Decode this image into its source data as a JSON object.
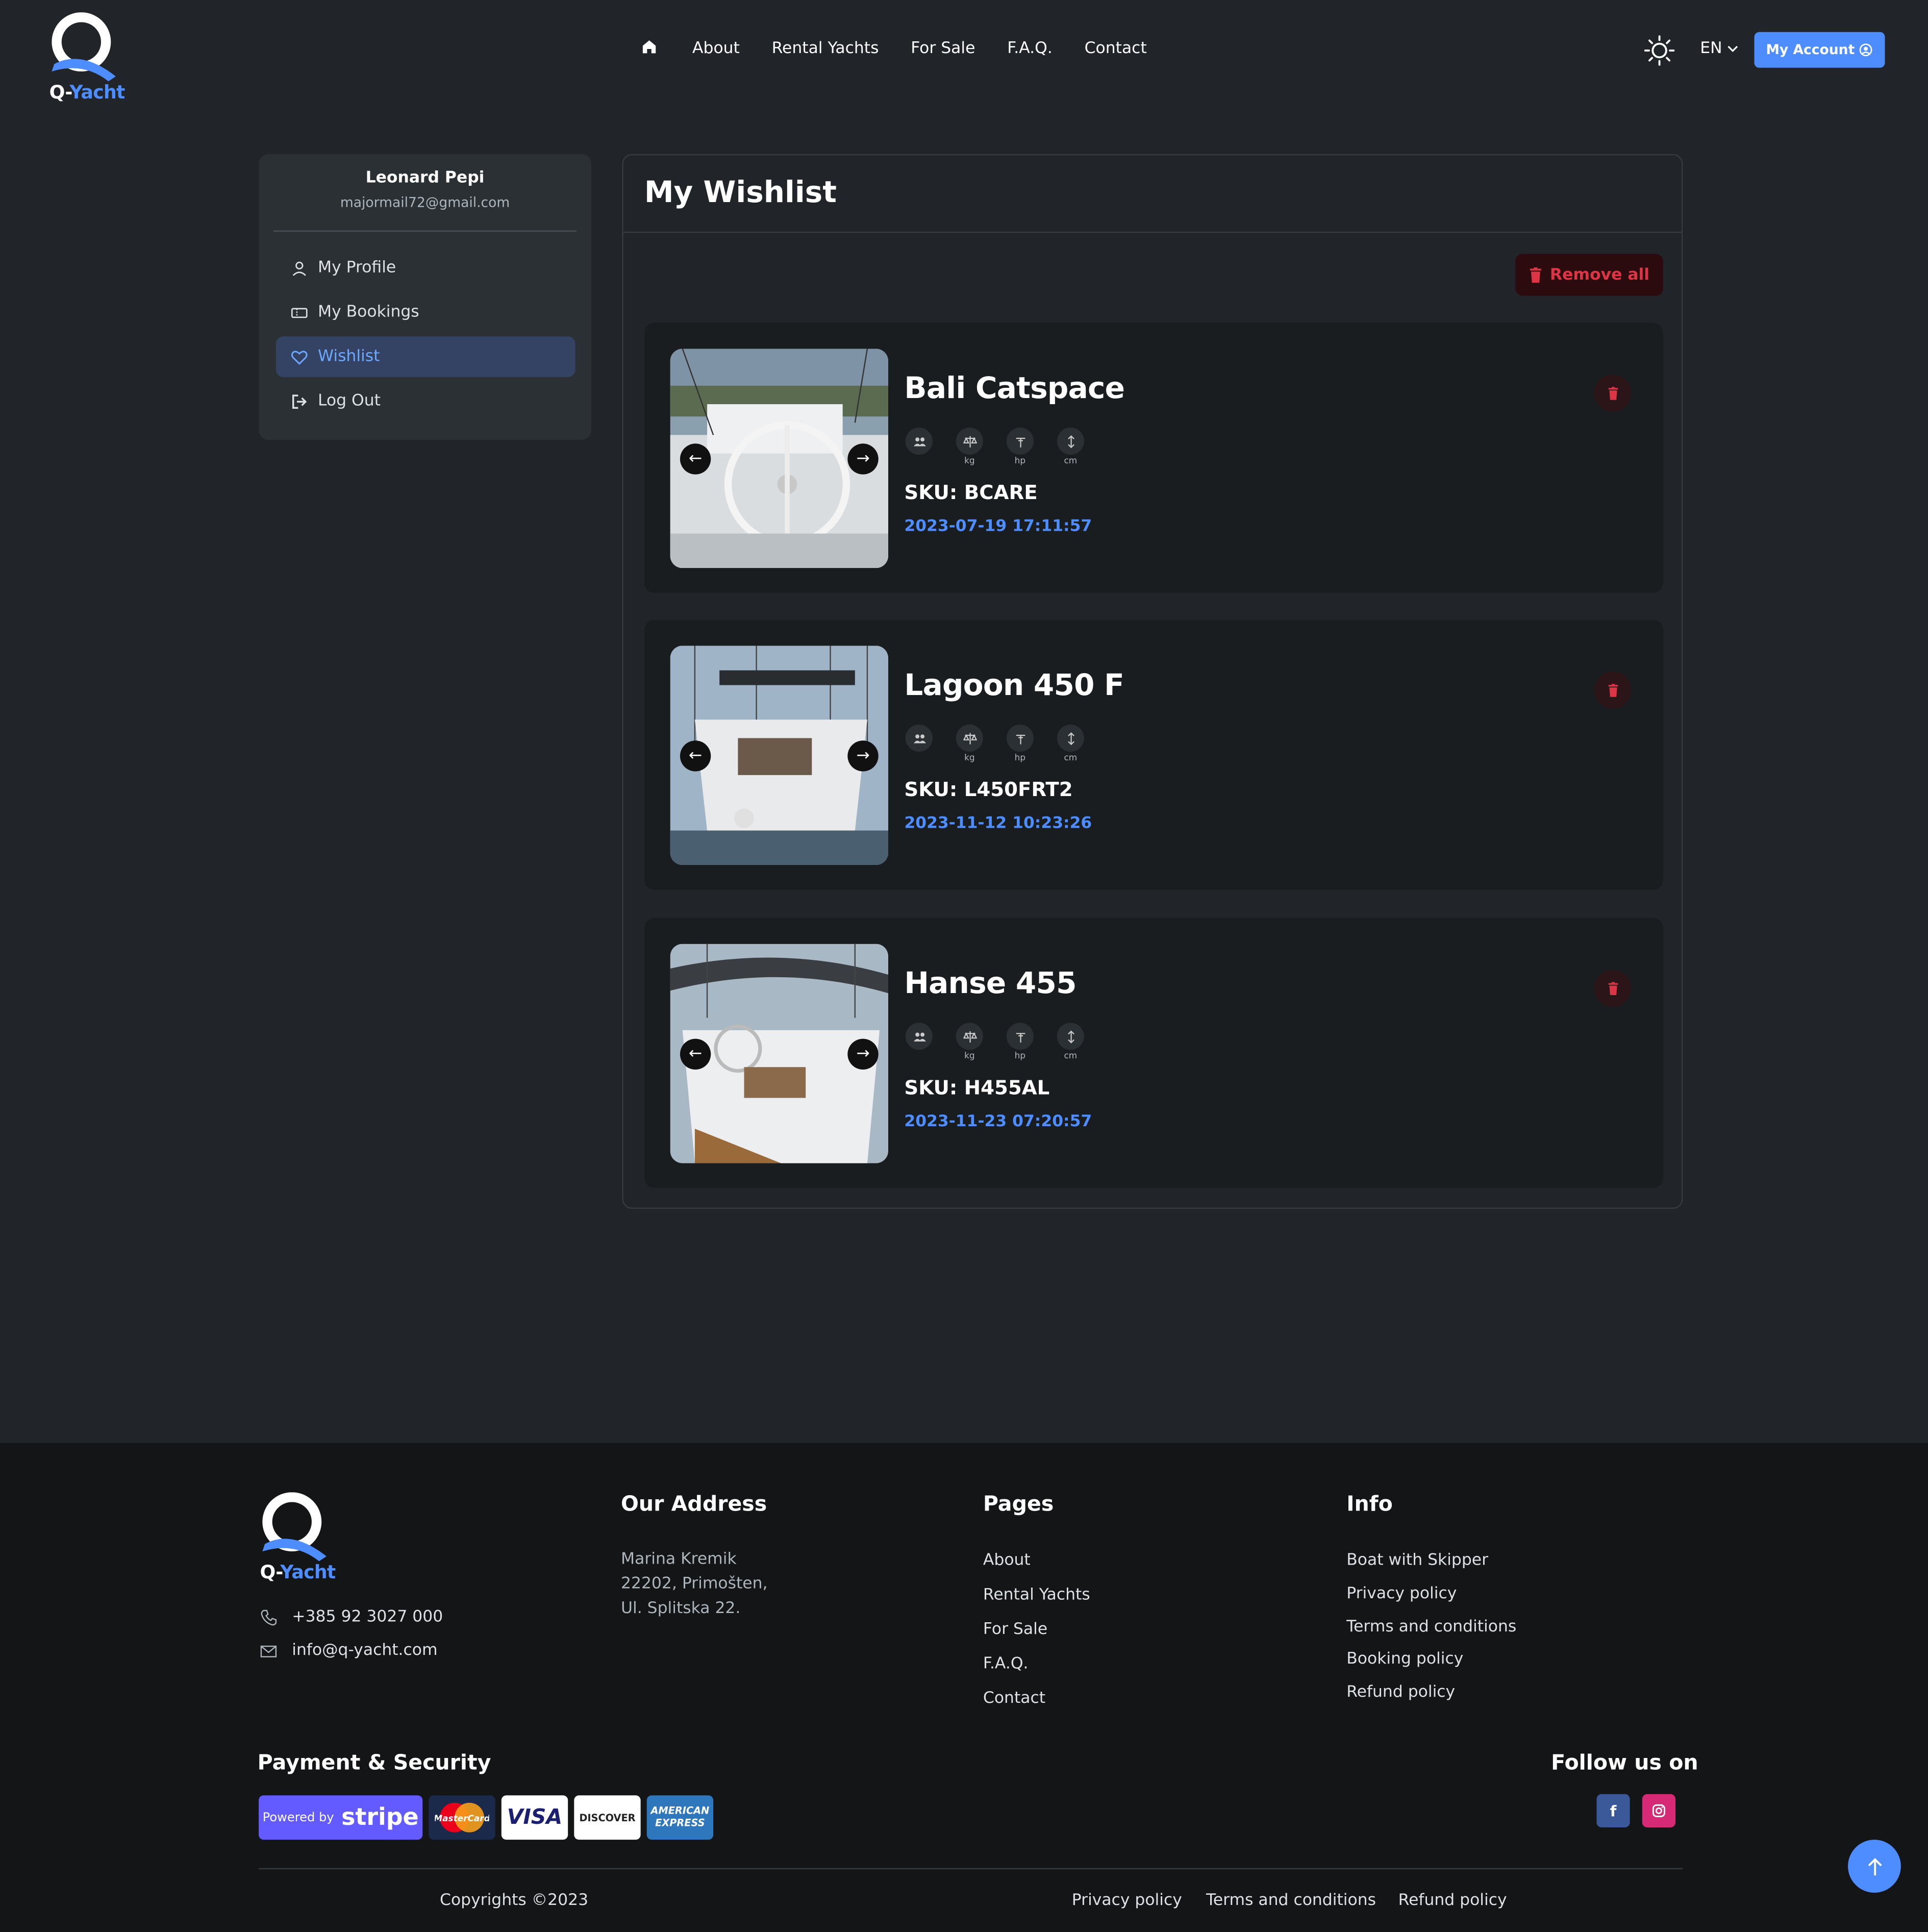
{
  "brand": {
    "logo_text_q": "Q-",
    "logo_text_yacht": "Yacht",
    "accent": "#4d8dff"
  },
  "header": {
    "nav": [
      "About",
      "Rental Yachts",
      "For Sale",
      "F.A.Q.",
      "Contact"
    ],
    "language": "EN",
    "account_button": "My Account"
  },
  "sidebar": {
    "user_name": "Leonard Pepi",
    "user_email": "majormail72@gmail.com",
    "items": [
      {
        "label": "My Profile",
        "icon": "user-icon"
      },
      {
        "label": "My Bookings",
        "icon": "ticket-icon"
      },
      {
        "label": "Wishlist",
        "icon": "heart-icon",
        "active": true
      },
      {
        "label": "Log Out",
        "icon": "logout-icon"
      }
    ]
  },
  "wishlist": {
    "title": "My Wishlist",
    "remove_all": "Remove all",
    "spec_units": [
      "kg",
      "hp",
      "cm"
    ],
    "items": [
      {
        "name": "Bali Catspace",
        "sku": "SKU: BCARE",
        "date": "2023-07-19 17:11:57"
      },
      {
        "name": "Lagoon 450 F",
        "sku": "SKU: L450FRT2",
        "date": "2023-11-12 10:23:26"
      },
      {
        "name": "Hanse 455",
        "sku": "SKU: H455AL",
        "date": "2023-11-23 07:20:57"
      }
    ]
  },
  "footer": {
    "phone": "+385 92 3027 000",
    "email": "info@q-yacht.com",
    "address_title": "Our Address",
    "address_lines": [
      "Marina Kremik",
      "22202, Primošten,",
      "Ul. Splitska 22."
    ],
    "pages_title": "Pages",
    "pages": [
      "About",
      "Rental Yachts",
      "For Sale",
      "F.A.Q.",
      "Contact"
    ],
    "info_title": "Info",
    "info": [
      "Boat with Skipper",
      "Privacy policy",
      "Terms and conditions",
      "Booking policy",
      "Refund policy"
    ],
    "payment_title": "Payment & Security",
    "payment": {
      "stripe_prefix": "Powered by",
      "stripe": "stripe",
      "mastercard": "MasterCard",
      "visa": "VISA",
      "discover": "DISCOVER",
      "amex_1": "AMERICAN",
      "amex_2": "EXPRESS"
    },
    "follow_title": "Follow us on",
    "social": {
      "facebook": "f"
    },
    "copyright": "Copyrights ©2023",
    "bottom_links": [
      "Privacy policy",
      "Terms and conditions",
      "Refund policy"
    ]
  }
}
